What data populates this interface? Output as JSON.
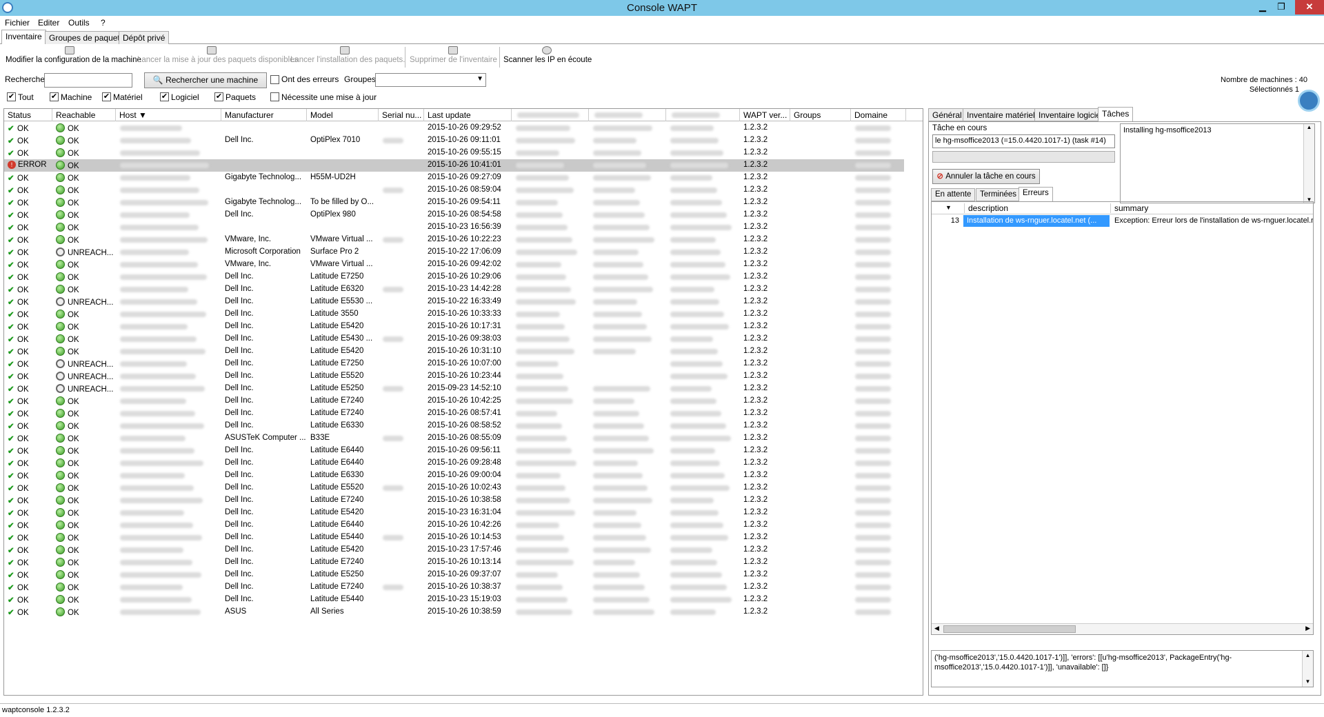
{
  "window": {
    "title": "Console WAPT",
    "min": "▁",
    "max": "❐",
    "close": "✕"
  },
  "menu": [
    "Fichier",
    "Editer",
    "Outils",
    "?"
  ],
  "main_tabs": [
    "Inventaire",
    "Groupes de paquets",
    "Dépôt privé"
  ],
  "toolbar": {
    "modify_config": "Modifier la configuration de la machine",
    "launch_update": "Lancer la mise à jour des paquets disponibles",
    "launch_install": "Lancer l'installation des paquets.",
    "remove_inventory": "Supprimer de l'inventaire",
    "scan_ip": "Scanner les IP en écoute"
  },
  "search": {
    "label": "Rechercher",
    "value": "",
    "button": "Rechercher une machine",
    "has_errors": "Ont des erreurs",
    "groups_label": "Groupes",
    "groups_value": ""
  },
  "stats": {
    "machines": "Nombre de machines : 40",
    "selected": "Sélectionnés   1"
  },
  "filters": [
    {
      "label": "Tout",
      "checked": true
    },
    {
      "label": "Machine",
      "checked": true
    },
    {
      "label": "Matériel",
      "checked": true
    },
    {
      "label": "Logiciel",
      "checked": true
    },
    {
      "label": "Paquets",
      "checked": true
    },
    {
      "label": "Nécessite une mise à jour",
      "checked": false
    }
  ],
  "columns": [
    "Status",
    "Reachable",
    "Host",
    "Manufacturer",
    "Model",
    "Serial nu...",
    "Last update",
    "WAPT ver...",
    "Groups",
    "Domaine"
  ],
  "rows": [
    {
      "status": "OK",
      "reach": "OK",
      "man": "",
      "model": "",
      "lu": "2015-10-26 09:29:52",
      "ver": "1.2.3.2"
    },
    {
      "status": "OK",
      "reach": "OK",
      "man": "Dell Inc.",
      "model": "OptiPlex 7010",
      "lu": "2015-10-26 09:11:01",
      "ver": "1.2.3.2"
    },
    {
      "status": "OK",
      "reach": "OK",
      "man": "",
      "model": "",
      "lu": "2015-10-26 09:55:15",
      "ver": "1.2.3.2"
    },
    {
      "status": "ERROR",
      "reach": "OK",
      "man": "",
      "model": "",
      "lu": "2015-10-26 10:41:01",
      "ver": "1.2.3.2",
      "sel": true
    },
    {
      "status": "OK",
      "reach": "OK",
      "man": "Gigabyte Technolog...",
      "model": "H55M-UD2H",
      "lu": "2015-10-26 09:27:09",
      "ver": "1.2.3.2"
    },
    {
      "status": "OK",
      "reach": "OK",
      "man": "",
      "model": "",
      "lu": "2015-10-26 08:59:04",
      "ver": "1.2.3.2"
    },
    {
      "status": "OK",
      "reach": "OK",
      "man": "Gigabyte Technolog...",
      "model": "To be filled by O...",
      "lu": "2015-10-26 09:54:11",
      "ver": "1.2.3.2"
    },
    {
      "status": "OK",
      "reach": "OK",
      "man": "Dell Inc.",
      "model": "OptiPlex 980",
      "lu": "2015-10-26 08:54:58",
      "ver": "1.2.3.2"
    },
    {
      "status": "OK",
      "reach": "OK",
      "man": "",
      "model": "",
      "lu": "2015-10-23 16:56:39",
      "ver": "1.2.3.2"
    },
    {
      "status": "OK",
      "reach": "OK",
      "man": "VMware, Inc.",
      "model": "VMware Virtual ...",
      "lu": "2015-10-26 10:22:23",
      "ver": "1.2.3.2"
    },
    {
      "status": "OK",
      "reach": "UNREACH...",
      "man": "Microsoft Corporation",
      "model": "Surface Pro 2",
      "lu": "2015-10-22 17:06:09",
      "ver": "1.2.3.2"
    },
    {
      "status": "OK",
      "reach": "OK",
      "man": "VMware, Inc.",
      "model": "VMware Virtual ...",
      "lu": "2015-10-26 09:42:02",
      "ver": "1.2.3.2"
    },
    {
      "status": "OK",
      "reach": "OK",
      "man": "Dell Inc.",
      "model": "Latitude E7250",
      "lu": "2015-10-26 10:29:06",
      "ver": "1.2.3.2"
    },
    {
      "status": "OK",
      "reach": "OK",
      "man": "Dell Inc.",
      "model": "Latitude E6320",
      "lu": "2015-10-23 14:42:28",
      "ver": "1.2.3.2"
    },
    {
      "status": "OK",
      "reach": "UNREACH...",
      "man": "Dell Inc.",
      "model": "Latitude E5530 ...",
      "lu": "2015-10-22 16:33:49",
      "ver": "1.2.3.2"
    },
    {
      "status": "OK",
      "reach": "OK",
      "man": "Dell Inc.",
      "model": "Latitude 3550",
      "lu": "2015-10-26 10:33:33",
      "ver": "1.2.3.2"
    },
    {
      "status": "OK",
      "reach": "OK",
      "man": "Dell Inc.",
      "model": "Latitude E5420",
      "lu": "2015-10-26 10:17:31",
      "ver": "1.2.3.2"
    },
    {
      "status": "OK",
      "reach": "OK",
      "man": "Dell Inc.",
      "model": "Latitude E5430 ...",
      "lu": "2015-10-26 09:38:03",
      "ver": "1.2.3.2"
    },
    {
      "status": "OK",
      "reach": "OK",
      "man": "Dell Inc.",
      "model": "Latitude E5420",
      "lu": "2015-10-26 10:31:10",
      "ver": "1.2.3.2"
    },
    {
      "status": "OK",
      "reach": "UNREACH...",
      "man": "Dell Inc.",
      "model": "Latitude E7250",
      "lu": "2015-10-26 10:07:00",
      "ver": "1.2.3.2"
    },
    {
      "status": "OK",
      "reach": "UNREACH...",
      "man": "Dell Inc.",
      "model": "Latitude E5520",
      "lu": "2015-10-26 10:23:44",
      "ver": "1.2.3.2"
    },
    {
      "status": "OK",
      "reach": "UNREACH...",
      "man": "Dell Inc.",
      "model": "Latitude E5250",
      "lu": "2015-09-23 14:52:10",
      "ver": "1.2.3.2"
    },
    {
      "status": "OK",
      "reach": "OK",
      "man": "Dell Inc.",
      "model": "Latitude E7240",
      "lu": "2015-10-26 10:42:25",
      "ver": "1.2.3.2"
    },
    {
      "status": "OK",
      "reach": "OK",
      "man": "Dell Inc.",
      "model": "Latitude E7240",
      "lu": "2015-10-26 08:57:41",
      "ver": "1.2.3.2"
    },
    {
      "status": "OK",
      "reach": "OK",
      "man": "Dell Inc.",
      "model": "Latitude E6330",
      "lu": "2015-10-26 08:58:52",
      "ver": "1.2.3.2"
    },
    {
      "status": "OK",
      "reach": "OK",
      "man": "ASUSTeK Computer ...",
      "model": "B33E",
      "lu": "2015-10-26 08:55:09",
      "ver": "1.2.3.2"
    },
    {
      "status": "OK",
      "reach": "OK",
      "man": "Dell Inc.",
      "model": "Latitude E6440",
      "lu": "2015-10-26 09:56:11",
      "ver": "1.2.3.2"
    },
    {
      "status": "OK",
      "reach": "OK",
      "man": "Dell Inc.",
      "model": "Latitude E6440",
      "lu": "2015-10-26 09:28:48",
      "ver": "1.2.3.2"
    },
    {
      "status": "OK",
      "reach": "OK",
      "man": "Dell Inc.",
      "model": "Latitude E6330",
      "lu": "2015-10-26 09:00:04",
      "ver": "1.2.3.2"
    },
    {
      "status": "OK",
      "reach": "OK",
      "man": "Dell Inc.",
      "model": "Latitude E5520",
      "lu": "2015-10-26 10:02:43",
      "ver": "1.2.3.2"
    },
    {
      "status": "OK",
      "reach": "OK",
      "man": "Dell Inc.",
      "model": "Latitude E7240",
      "lu": "2015-10-26 10:38:58",
      "ver": "1.2.3.2"
    },
    {
      "status": "OK",
      "reach": "OK",
      "man": "Dell Inc.",
      "model": "Latitude E5420",
      "lu": "2015-10-23 16:31:04",
      "ver": "1.2.3.2"
    },
    {
      "status": "OK",
      "reach": "OK",
      "man": "Dell Inc.",
      "model": "Latitude E6440",
      "lu": "2015-10-26 10:42:26",
      "ver": "1.2.3.2"
    },
    {
      "status": "OK",
      "reach": "OK",
      "man": "Dell Inc.",
      "model": "Latitude E5440",
      "lu": "2015-10-26 10:14:53",
      "ver": "1.2.3.2"
    },
    {
      "status": "OK",
      "reach": "OK",
      "man": "Dell Inc.",
      "model": "Latitude E5420",
      "lu": "2015-10-23 17:57:46",
      "ver": "1.2.3.2"
    },
    {
      "status": "OK",
      "reach": "OK",
      "man": "Dell Inc.",
      "model": "Latitude E7240",
      "lu": "2015-10-26 10:13:14",
      "ver": "1.2.3.2"
    },
    {
      "status": "OK",
      "reach": "OK",
      "man": "Dell Inc.",
      "model": "Latitude E5250",
      "lu": "2015-10-26 09:37:07",
      "ver": "1.2.3.2"
    },
    {
      "status": "OK",
      "reach": "OK",
      "man": "Dell Inc.",
      "model": "Latitude E7240",
      "lu": "2015-10-26 10:38:37",
      "ver": "1.2.3.2"
    },
    {
      "status": "OK",
      "reach": "OK",
      "man": "Dell Inc.",
      "model": "Latitude E5440",
      "lu": "2015-10-23 15:19:03",
      "ver": "1.2.3.2"
    },
    {
      "status": "OK",
      "reach": "OK",
      "man": "ASUS",
      "model": "All Series",
      "lu": "2015-10-26 10:38:59",
      "ver": "1.2.3.2"
    }
  ],
  "right_tabs": [
    "Général",
    "Inventaire matériel",
    "Inventaire logiciel",
    "Tâches"
  ],
  "task": {
    "current_label": "Tâche en cours",
    "current_value": "le hg-msoffice2013 (=15.0.4420.1017-1) (task #14)",
    "log": "Installing hg-msoffice2013",
    "cancel": "Annuler la tâche en cours"
  },
  "sub_tabs": [
    "En attente",
    "Terminées",
    "Erreurs"
  ],
  "errors_table": {
    "cols": [
      "description",
      "summary"
    ],
    "rows": [
      {
        "id": "13",
        "description": "Installation de ws-rnguer.locatel.net (...",
        "summary": "Exception: Erreur lors de l'installation de ws-rnguer.locatel.ne"
      }
    ]
  },
  "detail_text": "('hg-msoffice2013','15.0.4420.1017-1')]], 'errors': [[u'hg-msoffice2013', PackageEntry('hg-msoffice2013','15.0.4420.1017-1')]], 'unavailable': []}",
  "status_bar": "waptconsole 1.2.3.2",
  "colors": {
    "titlebar": "#7ec8e8",
    "selected_row": "#c9c9c9",
    "selection_blue": "#3399ff"
  }
}
